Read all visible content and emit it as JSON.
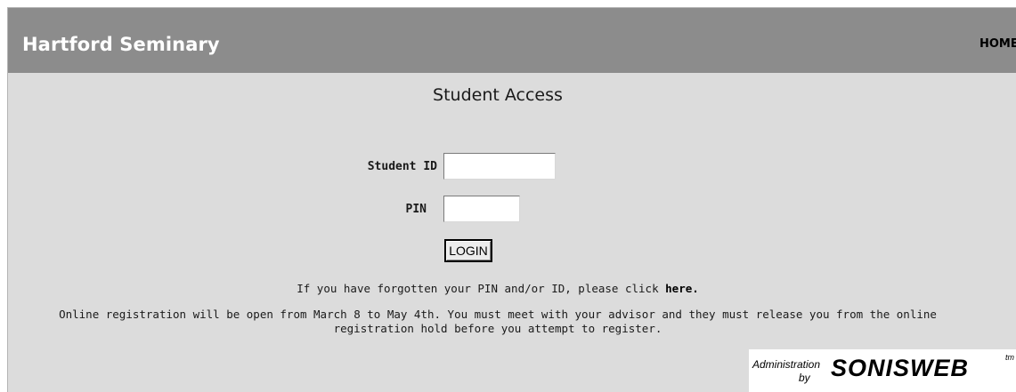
{
  "header": {
    "site_title": "Hartford Seminary",
    "home_link": "HOME"
  },
  "main": {
    "heading": "Student Access",
    "student_id_label": "Student ID",
    "student_id_value": "",
    "pin_label": "PIN",
    "pin_value": "",
    "login_label": "LOGIN",
    "forgot_text": "If you have forgotten your PIN and/or ID, please click ",
    "forgot_link": "here.",
    "notice": "Online registration will be open from March 8 to May 4th. You must meet with your advisor and they must release you from the online registration hold before you attempt to register."
  },
  "branding": {
    "admin_text": "Administration",
    "by_text": "by",
    "logo_text": "SONISWEB",
    "tm_text": "tm"
  },
  "colors": {
    "header_bg": "#8c8c8c",
    "page_bg": "#dcdcdc",
    "title_text": "#ffffff"
  }
}
